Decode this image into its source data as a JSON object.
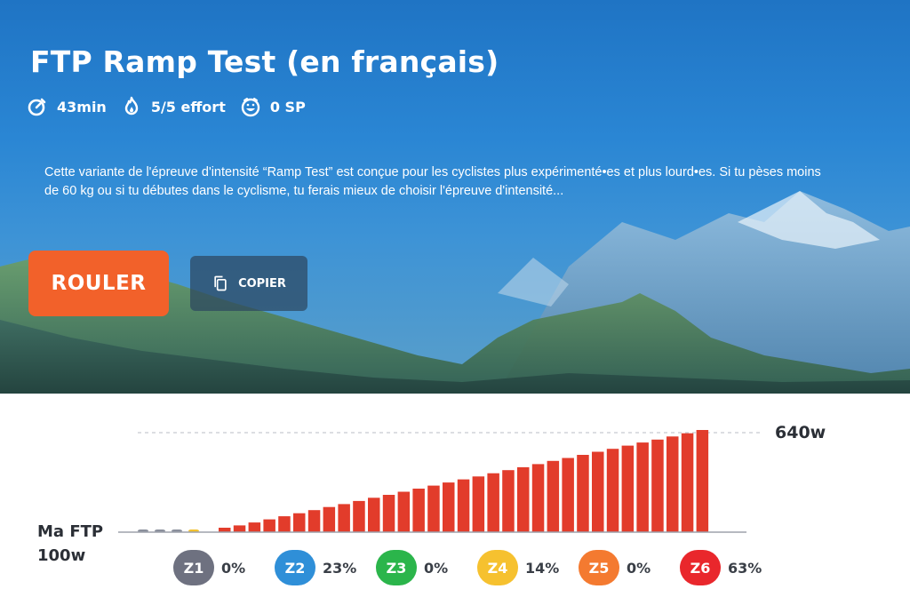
{
  "workout": {
    "title": "FTP Ramp Test (en français)",
    "stats": [
      {
        "icon": "stopwatch-icon",
        "label": "43min"
      },
      {
        "icon": "flame-icon",
        "label": "5/5 effort"
      },
      {
        "icon": "smiley-icon",
        "label": "0 SP"
      }
    ],
    "description": "Cette variante de l'épreuve d'intensité “Ramp Test” est conçue pour les cyclistes plus expérimenté•es et plus lourd•es. Si tu pèses moins de 60 kg ou si tu débutes dans le cyclisme, tu ferais mieux de choisir l'épreuve d'intensité..."
  },
  "actions": {
    "ride_label": "ROULER",
    "copy_label": "COPIER"
  },
  "chart_data": {
    "type": "bar",
    "max_label": "640w",
    "max_value": 640,
    "ftp_label_line1": "Ma FTP",
    "ftp_label_line2": "100w",
    "ftp_value": 100,
    "warmup_values": [
      60,
      40,
      70,
      90
    ],
    "warmup_colors": [
      "#8a8f9c",
      "#8a8f9c",
      "#8a8f9c",
      "#f2c12e"
    ],
    "ramp_values": [
      105,
      122,
      138,
      155,
      172,
      188,
      205,
      222,
      238,
      255,
      272,
      288,
      305,
      322,
      338,
      355,
      372,
      388,
      405,
      422,
      438,
      455,
      472,
      488,
      505,
      522,
      538,
      555,
      572,
      588,
      605,
      622,
      640
    ],
    "ramp_color": "#e23c2b"
  },
  "zones": [
    {
      "label": "Z1",
      "percent": "0%",
      "color": "#6e7180"
    },
    {
      "label": "Z2",
      "percent": "23%",
      "color": "#2f8fd8"
    },
    {
      "label": "Z3",
      "percent": "0%",
      "color": "#2bb54b"
    },
    {
      "label": "Z4",
      "percent": "14%",
      "color": "#f6c12f"
    },
    {
      "label": "Z5",
      "percent": "0%",
      "color": "#f47a30"
    },
    {
      "label": "Z6",
      "percent": "63%",
      "color": "#e9272c"
    }
  ]
}
